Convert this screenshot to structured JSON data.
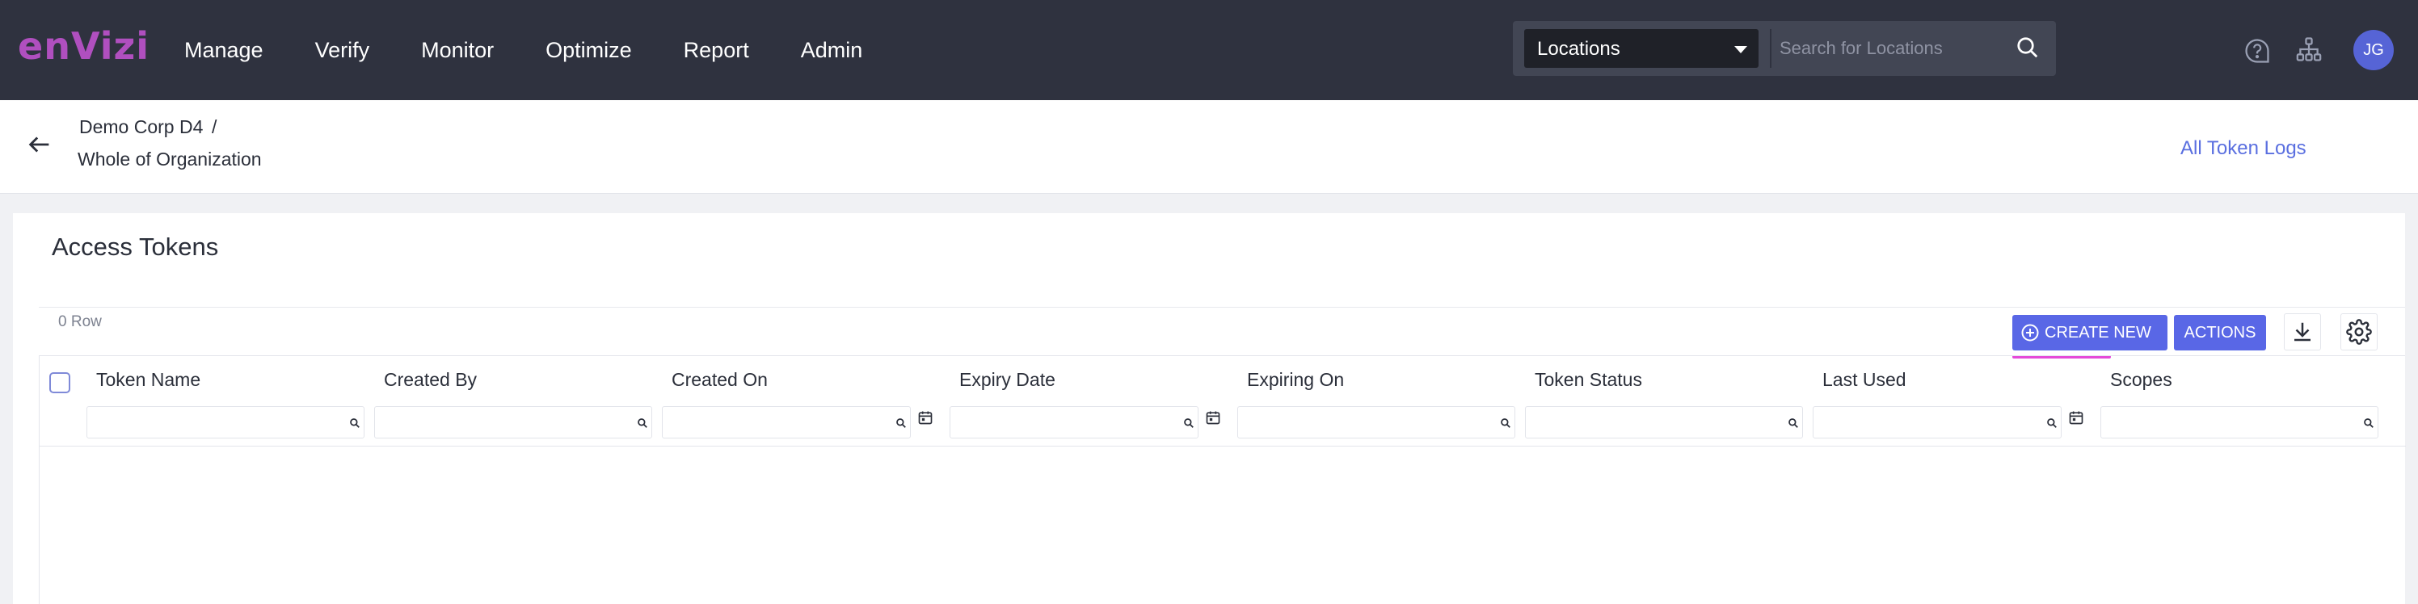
{
  "brand": {
    "logo_text": "enVizi",
    "logo_color": "#b04fbf"
  },
  "nav": {
    "items": [
      {
        "label": "Manage"
      },
      {
        "label": "Verify"
      },
      {
        "label": "Monitor"
      },
      {
        "label": "Optimize"
      },
      {
        "label": "Report"
      },
      {
        "label": "Admin"
      }
    ]
  },
  "search": {
    "scope_selected": "Locations",
    "placeholder": "Search for Locations",
    "icon": "search-icon"
  },
  "header_icons": {
    "help": "help-icon",
    "org": "org-hierarchy-icon"
  },
  "user": {
    "initials": "JG"
  },
  "breadcrumb": {
    "parent": "Demo Corp D4",
    "separator": "/",
    "current": "Whole of Organization"
  },
  "all_token_logs_label": "All Token Logs",
  "page": {
    "title": "Access Tokens",
    "row_count": "0 Row"
  },
  "toolbar": {
    "create_label": "CREATE NEW",
    "actions_label": "ACTIONS"
  },
  "table": {
    "columns": [
      {
        "label": "Token Name",
        "has_date": false
      },
      {
        "label": "Created By",
        "has_date": false
      },
      {
        "label": "Created On",
        "has_date": true
      },
      {
        "label": "Expiry Date",
        "has_date": true
      },
      {
        "label": "Expiring On",
        "has_date": false
      },
      {
        "label": "Token Status",
        "has_date": false
      },
      {
        "label": "Last Used",
        "has_date": true
      },
      {
        "label": "Scopes",
        "has_date": false
      }
    ],
    "rows": []
  },
  "colors": {
    "topbar": "#2f323f",
    "primary": "#5967e6",
    "link": "#5a6fe0",
    "accent_underline": "#e54ad9"
  }
}
